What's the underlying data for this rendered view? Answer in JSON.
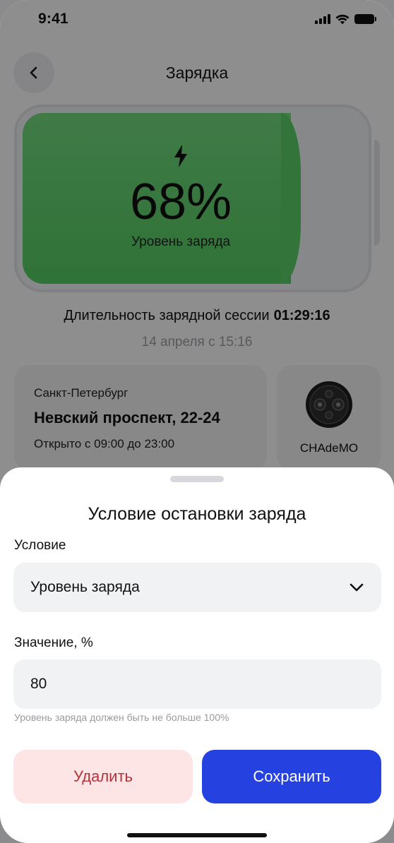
{
  "status_bar": {
    "time": "9:41"
  },
  "header": {
    "title": "Зарядка"
  },
  "battery": {
    "percent": "68%",
    "label": "Уровень заряда",
    "level": 0.68,
    "fill_color": "#55c763"
  },
  "session": {
    "label": "Длительность зарядной сессии",
    "duration": "01:29:16",
    "date": "14 апреля с 15:16"
  },
  "station": {
    "city": "Санкт-Петербург",
    "address": "Невский проспект, 22-24",
    "hours": "Открыто с 09:00 до 23:00"
  },
  "connector": {
    "label": "CHAdeMO",
    "icon": "chademo-connector-icon"
  },
  "sheet": {
    "title": "Условие остановки заряда",
    "condition_label": "Условие",
    "condition_value": "Уровень заряда",
    "value_label": "Значение, %",
    "value": "80",
    "hint": "Уровень заряда должен быть не больше 100%",
    "delete_label": "Удалить",
    "save_label": "Сохранить"
  },
  "colors": {
    "accent": "#2541e0",
    "danger_bg": "#fde5e6",
    "danger_text": "#b3333b",
    "battery_green": "#55c763"
  }
}
